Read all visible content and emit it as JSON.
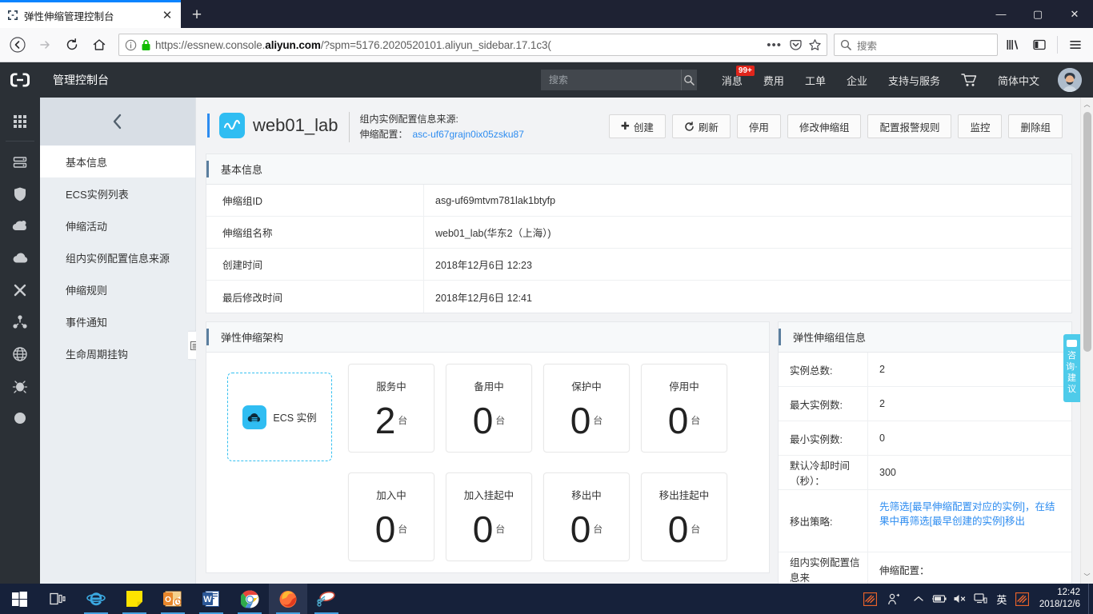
{
  "browser": {
    "tab": {
      "title": "弹性伸缩管理控制台",
      "favicon": "code-brackets-icon",
      "close": "✕"
    },
    "newtab_label": "+",
    "window_buttons": {
      "minimize": "—",
      "maximize": "▢",
      "close": "✕"
    },
    "nav": {
      "back": "←",
      "forward": "→",
      "reload": "⟳",
      "home": "⌂"
    },
    "url": {
      "prefix": "https://essnew.console.",
      "domain": "aliyun.com",
      "suffix": "/?spm=5176.2020520101.aliyun_sidebar.17.1c3("
    },
    "search": {
      "placeholder": "搜索"
    },
    "toolbar_icons": [
      "page-actions-icon",
      "pocket-icon",
      "bookmark-star-icon",
      "library-icon",
      "sidebar-icon",
      "menu-icon"
    ]
  },
  "console": {
    "logo": "aliyun-logo-icon",
    "title": "管理控制台",
    "search_placeholder": "搜索",
    "nav": [
      {
        "label": "消息",
        "badge": "99+"
      },
      {
        "label": "费用",
        "badge": ""
      },
      {
        "label": "工单",
        "badge": ""
      },
      {
        "label": "企业",
        "badge": ""
      },
      {
        "label": "支持与服务",
        "badge": ""
      }
    ],
    "cart": "cart-icon",
    "language": "简体中文"
  },
  "rail": {
    "items": [
      "apps-grid-icon",
      "server-icon",
      "shield-icon",
      "cloud-sync-icon",
      "cloud-icon",
      "cross-icon",
      "network-nodes-icon",
      "globe-icon",
      "bug-icon",
      "circle-icon"
    ]
  },
  "leftmenu": {
    "collapse": "‹",
    "handle": "⊟",
    "items": [
      {
        "label": "基本信息",
        "active": true
      },
      {
        "label": "ECS实例列表",
        "active": false
      },
      {
        "label": "伸缩活动",
        "active": false
      },
      {
        "label": "组内实例配置信息来源",
        "active": false
      },
      {
        "label": "伸缩规则",
        "active": false
      },
      {
        "label": "事件通知",
        "active": false
      },
      {
        "label": "生命周期挂钩",
        "active": false
      }
    ]
  },
  "header": {
    "icon": "scaling-group-icon",
    "title": "web01_lab",
    "source_line1": "组内实例配置信息来源:",
    "source_line2_label": "伸缩配置：",
    "source_link": "asc-uf67grajn0ix05zsku87",
    "buttons": [
      {
        "label": "创建",
        "icon": "plus-icon"
      },
      {
        "label": "刷新",
        "icon": "refresh-icon"
      },
      {
        "label": "停用",
        "icon": ""
      },
      {
        "label": "修改伸缩组",
        "icon": ""
      },
      {
        "label": "配置报警规则",
        "icon": ""
      },
      {
        "label": "监控",
        "icon": ""
      },
      {
        "label": "删除组",
        "icon": ""
      }
    ]
  },
  "basic_info": {
    "title": "基本信息",
    "rows": [
      {
        "label": "伸缩组ID",
        "value": "asg-uf69mtvm781lak1btyfp"
      },
      {
        "label": "伸缩组名称",
        "value": "web01_lab(华东2（上海）)"
      },
      {
        "label": "创建时间",
        "value": "2018年12月6日 12:23"
      },
      {
        "label": "最后修改时间",
        "value": "2018年12月6日 12:41"
      }
    ]
  },
  "architecture": {
    "title": "弹性伸缩架构",
    "ecs_box": {
      "label": "ECS 实例",
      "icon": "ecs-cloud-icon"
    },
    "unit": "台",
    "stats": [
      {
        "name": "服务中",
        "value": "2"
      },
      {
        "name": "备用中",
        "value": "0"
      },
      {
        "name": "保护中",
        "value": "0"
      },
      {
        "name": "停用中",
        "value": "0"
      },
      {
        "name": "加入中",
        "value": "0"
      },
      {
        "name": "加入挂起中",
        "value": "0"
      },
      {
        "name": "移出中",
        "value": "0"
      },
      {
        "name": "移出挂起中",
        "value": "0"
      }
    ]
  },
  "group_info": {
    "title": "弹性伸缩组信息",
    "rows": [
      {
        "label": "实例总数:",
        "value": "2",
        "link": false
      },
      {
        "label": "最大实例数:",
        "value": "2",
        "link": false
      },
      {
        "label": "最小实例数:",
        "value": "0",
        "link": false
      },
      {
        "label": "默认冷却时间（秒）：",
        "value": "300",
        "link": false
      },
      {
        "label": "移出策略:",
        "value": "先筛选[最早伸缩配置对应的实例]，在结果中再筛选[最早创建的实例]移出",
        "link": false
      },
      {
        "label": "组内实例配置信息来",
        "value": "伸缩配置：",
        "link": false
      }
    ]
  },
  "consult": {
    "label": "咨询·建议",
    "icon": "chat-bubble-icon"
  },
  "scrollbar": {
    "up": "︿",
    "down": "﹀"
  },
  "taskbar": {
    "start": "windows-start-icon",
    "items": [
      "task-view-icon",
      "internet-explorer-icon",
      "sticky-notes-icon",
      "outlook-icon",
      "word-icon",
      "chrome-icon",
      "firefox-icon",
      "snipping-tool-icon"
    ],
    "tray": [
      "xunlei-icon",
      "people-icon",
      "show-hidden-icons-icon",
      "battery-icon",
      "volume-muted-icon",
      "network-icon",
      "ime-chinese-icon",
      "xunlei-tray-icon"
    ],
    "ime_label": "英",
    "clock_time": "12:42",
    "clock_date": "2018/12/6"
  }
}
